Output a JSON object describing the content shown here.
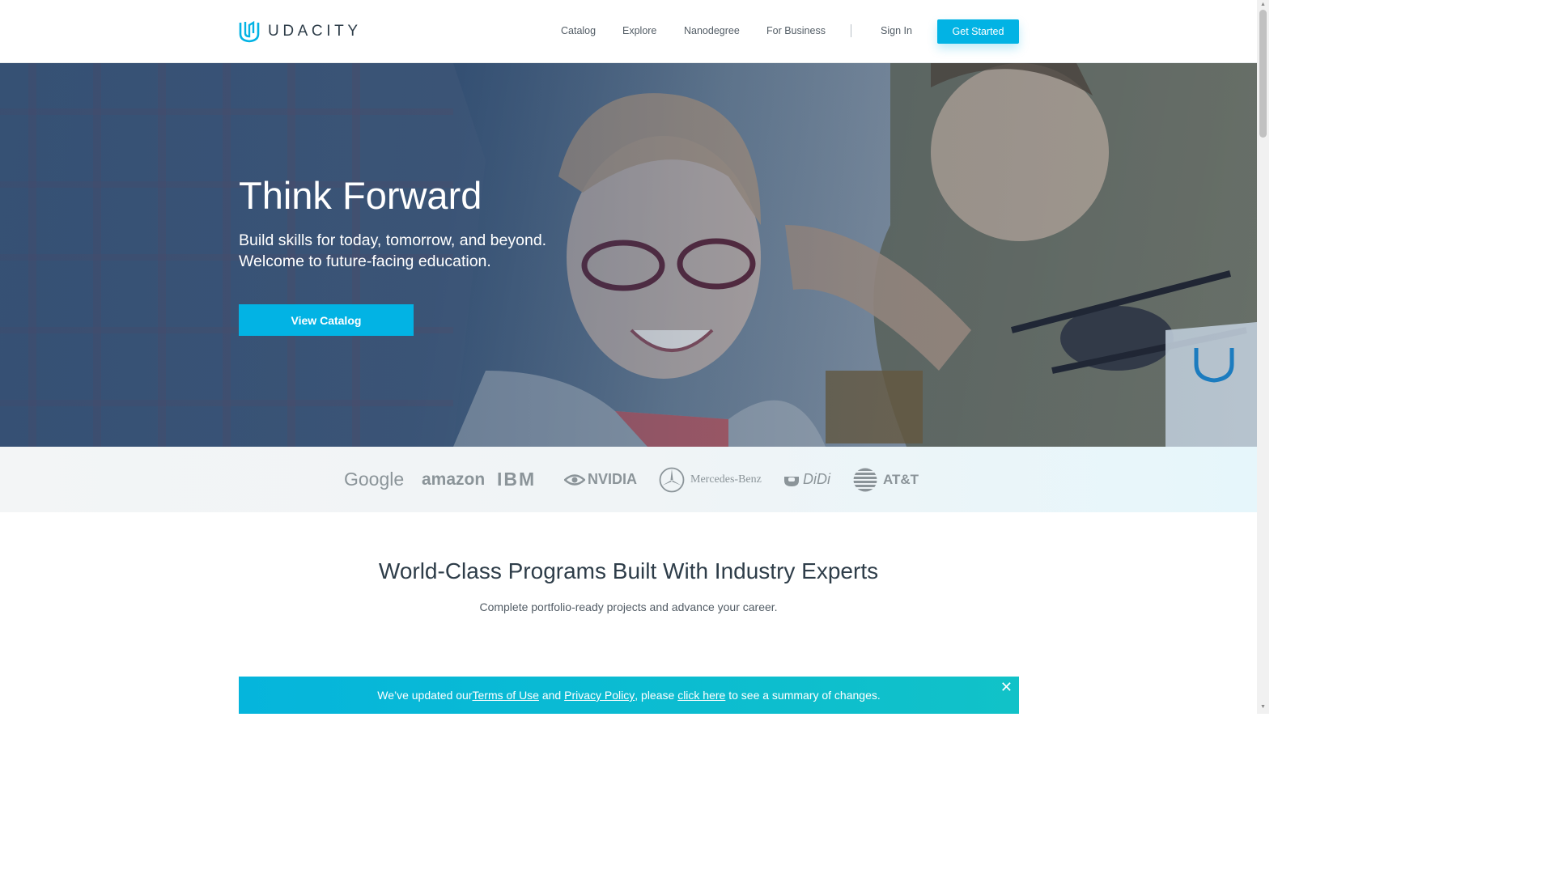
{
  "header": {
    "brand": "UDACITY",
    "nav": [
      {
        "label": "Catalog"
      },
      {
        "label": "Explore"
      },
      {
        "label": "Nanodegree"
      },
      {
        "label": "For Business"
      }
    ],
    "sign_in": "Sign In",
    "get_started": "Get Started"
  },
  "hero": {
    "title": "Think Forward",
    "subtitle_line1": "Build skills for today, tomorrow, and beyond.",
    "subtitle_line2": "Welcome to future-facing education.",
    "cta": "View Catalog"
  },
  "partners": [
    {
      "name": "Google"
    },
    {
      "name": "amazon"
    },
    {
      "name": "IBM"
    },
    {
      "name": "NVIDIA"
    },
    {
      "name": "Mercedes-Benz"
    },
    {
      "name": "DiDi"
    },
    {
      "name": "AT&T"
    }
  ],
  "section": {
    "title": "World-Class Programs Built With Industry Experts",
    "subtitle": "Complete portfolio-ready projects and advance your career."
  },
  "banner": {
    "text_before": "We’ve updated our ",
    "terms_link": "Terms of Use",
    "text_and": " and ",
    "privacy_link": "Privacy Policy",
    "text_please": ", please ",
    "click_link": "click here",
    "text_after": " to see a summary of changes.",
    "close": "✕"
  },
  "colors": {
    "accent": "#02b3e4",
    "banner": "#05b5dc",
    "text_dark": "#2e3d49"
  }
}
